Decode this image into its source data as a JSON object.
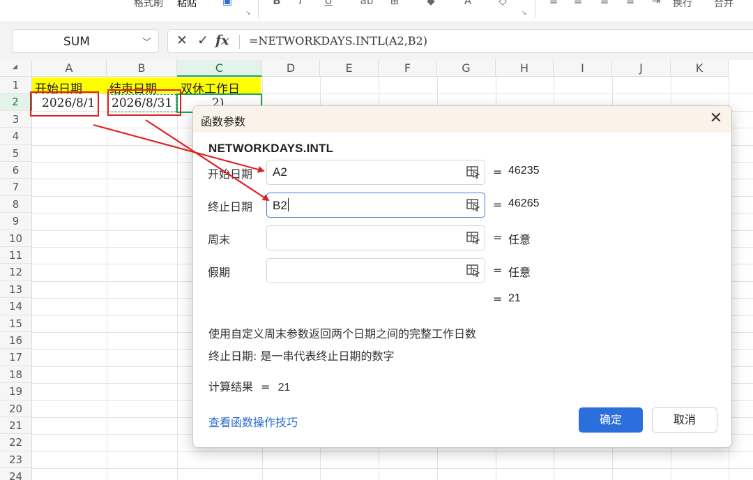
{
  "ribbon": {
    "format_painter": "格式刷",
    "paste": "粘贴",
    "wrap": "换行",
    "merge": "合并",
    "icons": [
      "paste-special-icon",
      "bold-icon",
      "italic-icon",
      "underline-icon",
      "strikethrough-icon",
      "border-icon",
      "fill-color-icon",
      "font-color-icon",
      "clear-icon",
      "align-left-icon",
      "align-center-icon",
      "align-right-icon",
      "indent-icon"
    ]
  },
  "formula_bar": {
    "name_box": "SUM",
    "cancel": "✕",
    "confirm": "✓",
    "fx": "fx",
    "formula": "=NETWORKDAYS.INTL(A2,B2)"
  },
  "sheet": {
    "columns": [
      "A",
      "B",
      "C",
      "D",
      "E",
      "F",
      "G",
      "H",
      "I",
      "J",
      "K"
    ],
    "rows": [
      "1",
      "2",
      "3",
      "4",
      "5",
      "6",
      "7",
      "8",
      "9",
      "10",
      "11",
      "12",
      "13",
      "14",
      "15",
      "16",
      "17",
      "18",
      "19",
      "20",
      "21",
      "22",
      "23",
      "24"
    ],
    "cells": {
      "A1": "开始日期",
      "B1": "结束日期",
      "C1": "双休工作日",
      "A2": "2026/8/1",
      "B2": "2026/8/31",
      "C2": "2)"
    },
    "highlight_color": "#ffff00",
    "selection_color": "#21a35a"
  },
  "dialog": {
    "title": "函数参数",
    "close": "✕",
    "function_name": "NETWORKDAYS.INTL",
    "args": [
      {
        "label": "开始日期",
        "value": "A2",
        "result": "46235"
      },
      {
        "label": "终止日期",
        "value": "B2",
        "result": "46265"
      },
      {
        "label": "周末",
        "value": "",
        "result": "任意"
      },
      {
        "label": "假期",
        "value": "",
        "result": "任意"
      }
    ],
    "equals": "=",
    "formula_result": "21",
    "description": "使用自定义周末参数返回两个日期之间的完整工作日数",
    "arg_help": "终止日期:  是一串代表终止日期的数字",
    "calc_label": "计算结果",
    "calc_result": "21",
    "help_link": "查看函数操作技巧",
    "ok": "确定",
    "cancel": "取消",
    "accent_color": "#2b6fdc"
  },
  "annotation": {
    "color": "#e02020"
  }
}
